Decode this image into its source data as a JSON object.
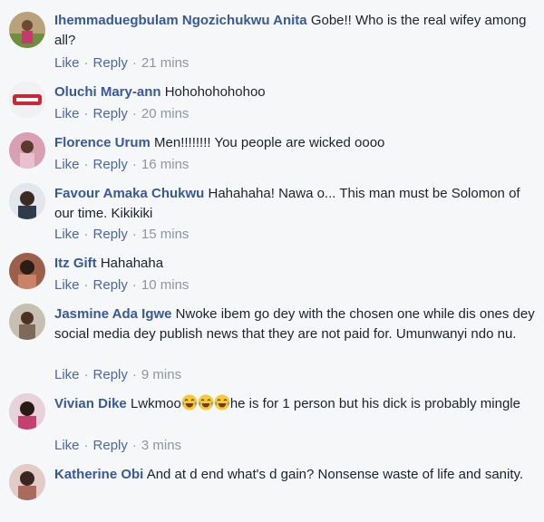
{
  "actions": {
    "like": "Like",
    "reply": "Reply",
    "separator": "·"
  },
  "comments": [
    {
      "name": "Ihemmaduegbulam Ngozichukwu Anita",
      "text": "Gobe!! Who is the real wifey among all?",
      "time": "21 mins"
    },
    {
      "name": "Oluchi Mary-ann",
      "text": "Hohohohohohoo",
      "time": "20 mins"
    },
    {
      "name": "Florence Urum",
      "text": "Men!!!!!!!! You people are wicked oooo",
      "time": "16 mins"
    },
    {
      "name": "Favour Amaka Chukwu",
      "text": "Hahahaha! Nawa o... This man must be Solomon of our time. Kikikiki",
      "time": "15 mins"
    },
    {
      "name": "Itz Gift",
      "text": "Hahahaha",
      "time": "10 mins"
    },
    {
      "name": "Jasmine Ada Igwe",
      "text": "Nwoke ibem go dey with the chosen one while dis ones dey social media dey publish news that they are not paid for. Umunwanyi ndo nu.",
      "time": "9 mins"
    },
    {
      "name": "Vivian Dike",
      "text_before": "Lwkmoo",
      "text_after": "he is for 1 person but his dick is probably mingle",
      "emoji_names": [
        "laughing-emoji",
        "laughing-emoji",
        "laughing-emoji"
      ],
      "time": "3 mins"
    },
    {
      "name": "Katherine Obi",
      "text": "And at d end what's d gain? Nonsense waste of life and sanity."
    }
  ]
}
